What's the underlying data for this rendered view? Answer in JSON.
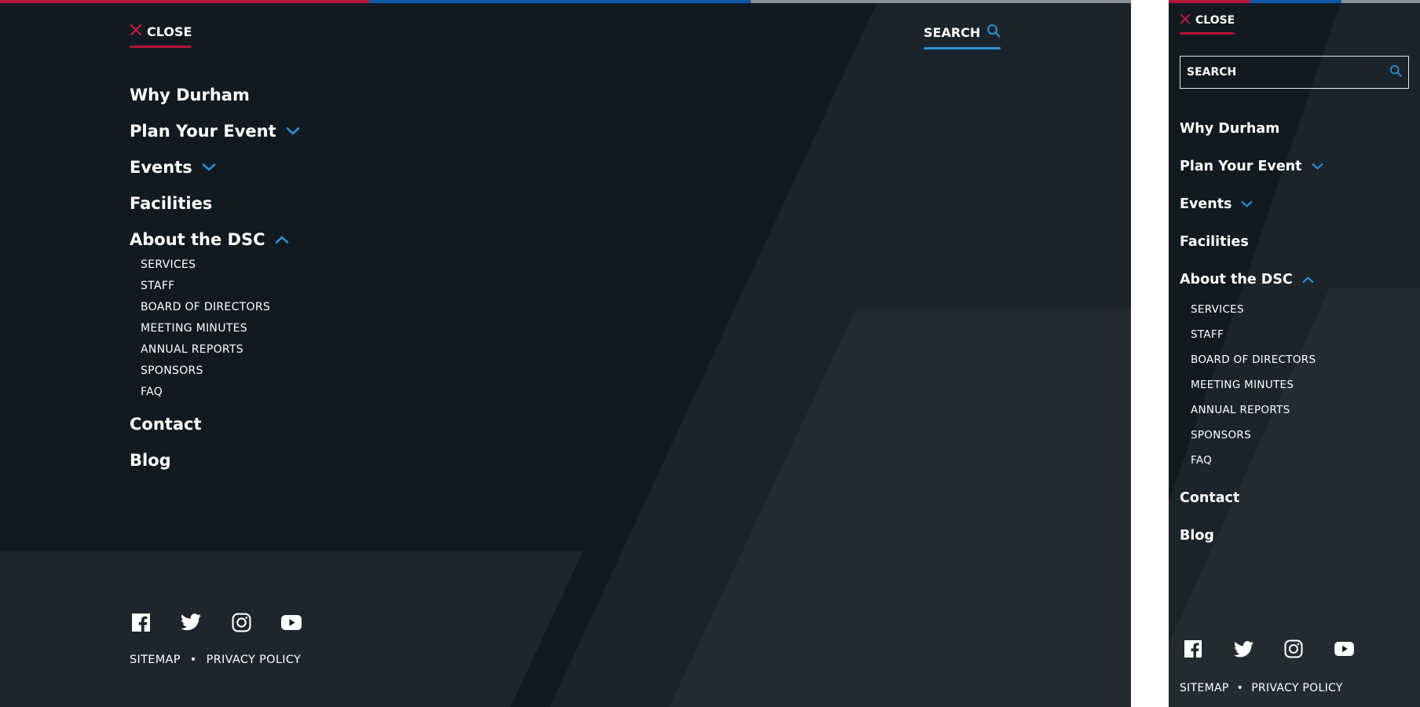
{
  "colors": {
    "background": "#111921",
    "accent_red": "#b3163a",
    "accent_blue": "#2a8fd7",
    "text": "#ffffff"
  },
  "desktop": {
    "close_label": "CLOSE",
    "search_label": "SEARCH",
    "nav": [
      {
        "label": "Why Durham",
        "icon": null
      },
      {
        "label": "Plan Your Event",
        "icon": "chevron-down-icon"
      },
      {
        "label": "Events",
        "icon": "chevron-down-icon"
      },
      {
        "label": "Facilities",
        "icon": null
      },
      {
        "label": "About the DSC",
        "icon": "chevron-up-icon",
        "expanded": true,
        "children": [
          "SERVICES",
          "STAFF",
          "BOARD OF DIRECTORS",
          "MEETING MINUTES",
          "ANNUAL REPORTS",
          "SPONSORS",
          "FAQ"
        ]
      },
      {
        "label": "Contact",
        "icon": null
      },
      {
        "label": "Blog",
        "icon": null
      }
    ],
    "social": [
      "facebook-icon",
      "twitter-icon",
      "instagram-icon",
      "youtube-icon"
    ],
    "legal": {
      "sitemap": "SITEMAP",
      "separator": "•",
      "privacy": "PRIVACY POLICY"
    }
  },
  "mobile": {
    "close_label": "CLOSE",
    "search_placeholder": "SEARCH",
    "nav": [
      {
        "label": "Why Durham",
        "icon": null
      },
      {
        "label": "Plan Your Event",
        "icon": "chevron-down-icon"
      },
      {
        "label": "Events",
        "icon": "chevron-down-icon"
      },
      {
        "label": "Facilities",
        "icon": null
      },
      {
        "label": "About the DSC",
        "icon": "chevron-up-icon",
        "expanded": true,
        "children": [
          "SERVICES",
          "STAFF",
          "BOARD OF DIRECTORS",
          "MEETING MINUTES",
          "ANNUAL REPORTS",
          "SPONSORS",
          "FAQ"
        ]
      },
      {
        "label": "Contact",
        "icon": null
      },
      {
        "label": "Blog",
        "icon": null
      }
    ],
    "social": [
      "facebook-icon",
      "twitter-icon",
      "instagram-icon",
      "youtube-icon"
    ],
    "legal": {
      "sitemap": "SITEMAP",
      "separator": "•",
      "privacy": "PRIVACY POLICY"
    }
  }
}
